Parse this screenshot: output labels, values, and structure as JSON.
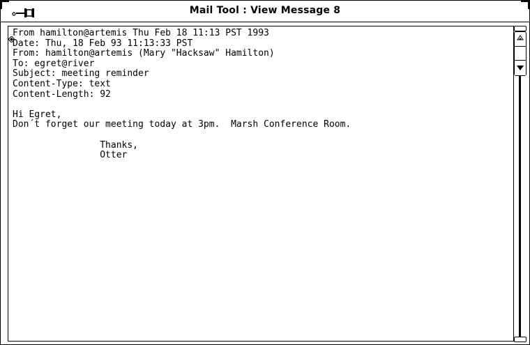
{
  "window": {
    "title": "Mail Tool : View Message 8"
  },
  "message": {
    "headers": [
      "From hamilton@artemis Thu Feb 18 11:13 PST 1993",
      "Date: Thu, 18 Feb 93 11:13:33 PST",
      "From: hamilton@artemis (Mary \"Hacksaw\" Hamilton)",
      "To: egret@river",
      "Subject: meeting reminder",
      "Content-Type: text",
      "Content-Length: 92"
    ],
    "body": [
      "",
      "Hi Egret,",
      "Don´t forget our meeting today at 3pm.  Marsh Conference Room.",
      "",
      "                Thanks,",
      "                Otter"
    ]
  },
  "icons": {
    "pushpin": "pushpin-icon",
    "scroll_up": "scroll-up-arrow-icon",
    "scroll_down": "scroll-down-arrow-icon",
    "caret": "text-caret-icon"
  }
}
